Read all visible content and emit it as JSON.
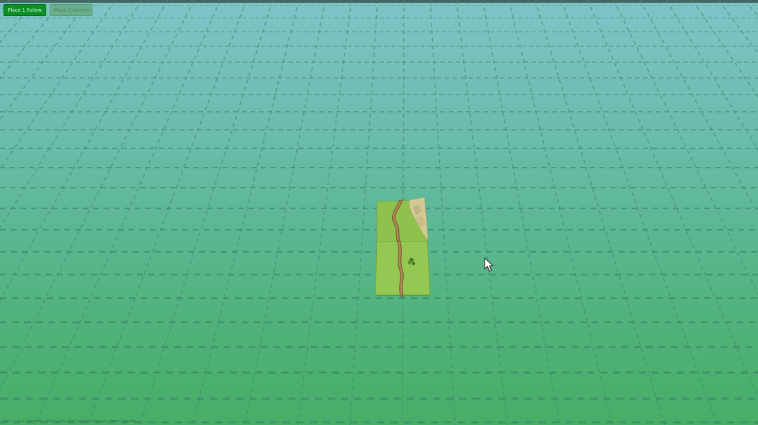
{
  "toolbar": {
    "primary_button": "Place 1 Follow",
    "secondary_button": "Place 1 Farmer"
  },
  "board": {
    "tiles": [
      {
        "name": "tile-city-road",
        "features": [
          "road",
          "city"
        ]
      },
      {
        "name": "tile-road-monastery",
        "features": [
          "road",
          "shrub"
        ]
      }
    ]
  },
  "status": {
    "text": "Turn 1 - It is your turn. Place a tile, then place a follower. Press F to skip."
  },
  "colors": {
    "primary_button": "#0c8f24",
    "secondary_button": "#69ad8a",
    "grid_line": "#3f8a6d",
    "sky_top": "#7ec4c8",
    "ground_bottom": "#47ad67",
    "grass_tile": "#8fc24d",
    "road": "#9a7442"
  }
}
